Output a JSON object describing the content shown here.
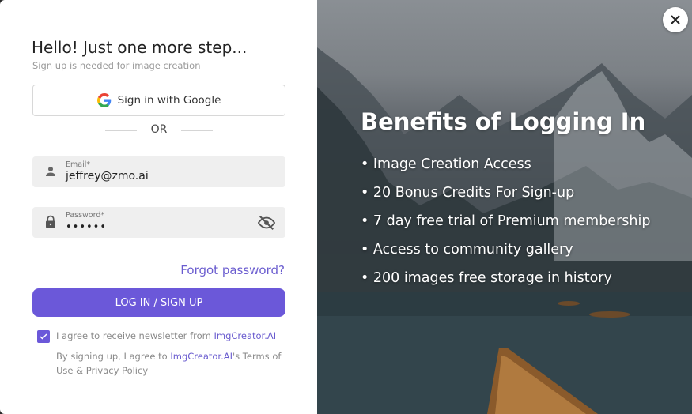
{
  "signup": {
    "title": "Hello! Just one more step...",
    "subtitle": "Sign up is needed for image creation",
    "google_button": "Sign in with Google",
    "or": "OR",
    "email": {
      "label": "Email*",
      "value": "jeffrey@zmo.ai"
    },
    "password": {
      "label": "Password*",
      "value": "••••••"
    },
    "forgot": "Forgot password?",
    "login_button": "LOG IN / SIGN UP",
    "newsletter": {
      "prefix": "I agree to receive newsletter from ",
      "brand": "ImgCreator.AI",
      "checked": true
    },
    "terms": {
      "prefix": "By signing up, I agree to ",
      "brand": "ImgCreator.AI",
      "suffix": "'s Terms of Use & Privacy Policy"
    }
  },
  "benefits": {
    "title": "Benefits of Logging In",
    "items": [
      "• Image Creation Access",
      "• 20 Bonus Credits For Sign-up",
      "• 7 day free trial of Premium membership",
      "• Access to community gallery",
      "• 200 images free storage in history"
    ]
  },
  "colors": {
    "accent": "#6b58d9",
    "link": "#6a5ccf"
  },
  "icons": {
    "close": "close-icon",
    "google": "google-logo-icon",
    "user": "user-icon",
    "lock": "lock-icon",
    "eye": "eye-off-icon",
    "check": "checkmark-icon"
  }
}
